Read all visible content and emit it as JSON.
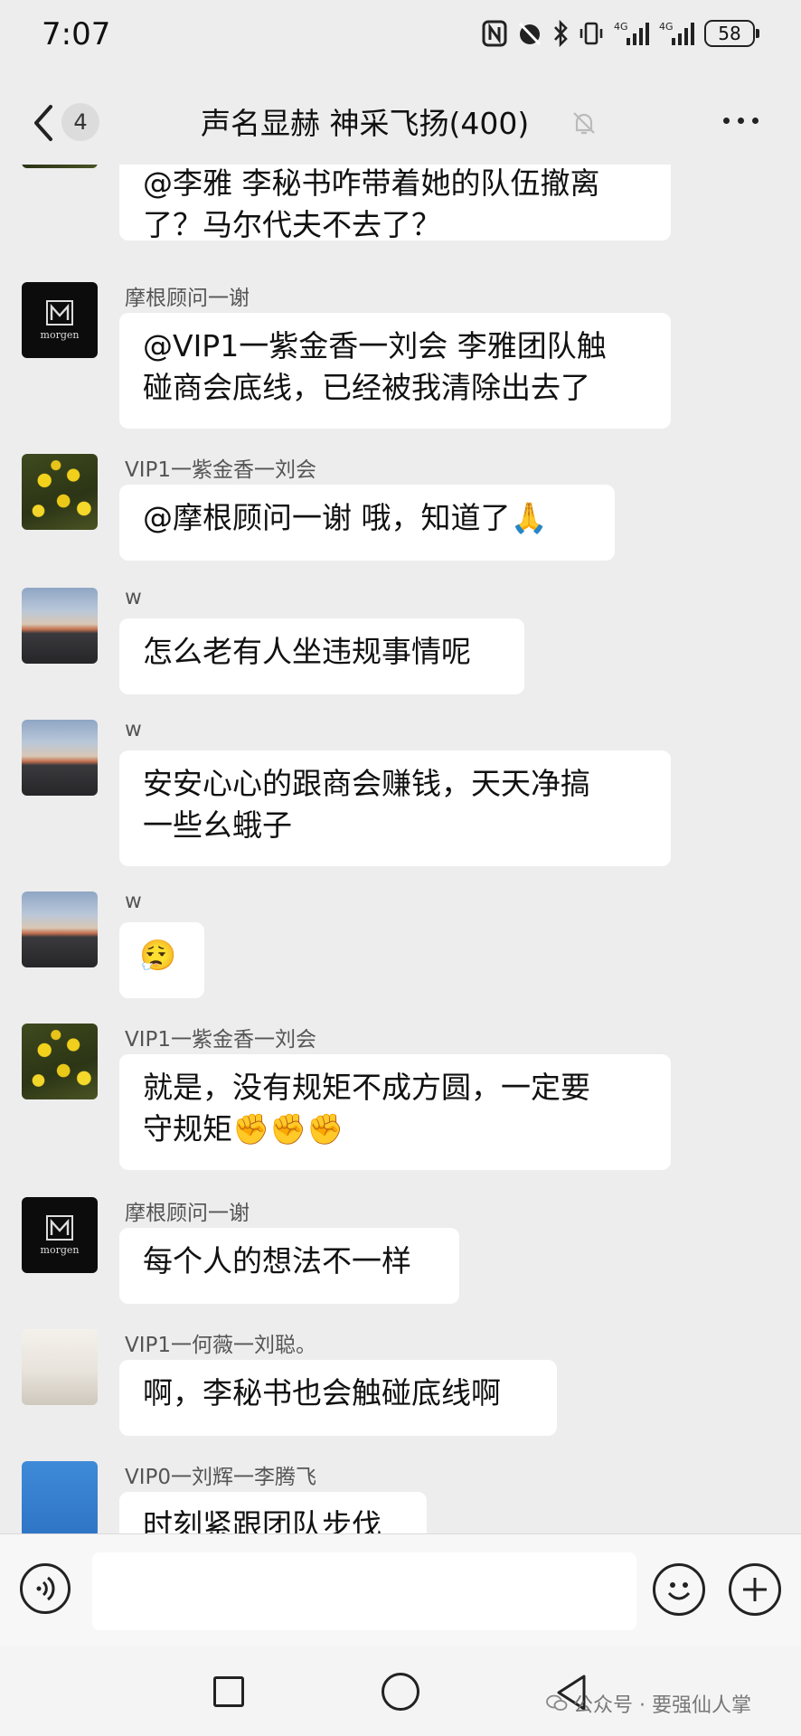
{
  "status_bar": {
    "time": "7:07",
    "battery": "58"
  },
  "header": {
    "unread_count": "4",
    "title": "声名显赫  神采飞扬(400)"
  },
  "messages": [
    {
      "lines": [
        "@李雅 李秘书咋带着她的队伍撤离",
        "了？马尔代夫不去了？"
      ]
    },
    {
      "sender": "摩根顾问一谢",
      "lines": [
        "@VIP1一紫金香一刘会  李雅团队触",
        "碰商会底线，已经被我清除出去了"
      ]
    },
    {
      "sender": "VIP1一紫金香一刘会",
      "lines": [
        "@摩根顾问一谢  哦，知道了🙏"
      ]
    },
    {
      "sender": "w",
      "lines": [
        "怎么老有人坐违规事情呢"
      ]
    },
    {
      "sender": "w",
      "lines": [
        "安安心心的跟商会赚钱，天天净搞",
        "一些幺蛾子"
      ]
    },
    {
      "sender": "w",
      "lines": [
        "😮‍💨"
      ]
    },
    {
      "sender": "VIP1一紫金香一刘会",
      "lines": [
        "就是，没有规矩不成方圆，一定要",
        "守规矩✊✊✊"
      ]
    },
    {
      "sender": "摩根顾问一谢",
      "lines": [
        "每个人的想法不一样"
      ]
    },
    {
      "sender": "VIP1一何薇一刘聪。",
      "lines": [
        "啊，李秘书也会触碰底线啊"
      ]
    },
    {
      "sender": "VIP0一刘辉一李腾飞",
      "lines": [
        "时刻紧跟团队步伐"
      ]
    }
  ],
  "avatar_text": {
    "morgen": "morgen"
  },
  "icons": {
    "back": "chevron-left-icon",
    "mute": "bell-off-icon",
    "more": "more-dots-icon",
    "voice": "voice-icon",
    "emoji": "smile-icon",
    "plus": "plus-icon"
  },
  "watermark": "公众号 · 要强仙人掌"
}
